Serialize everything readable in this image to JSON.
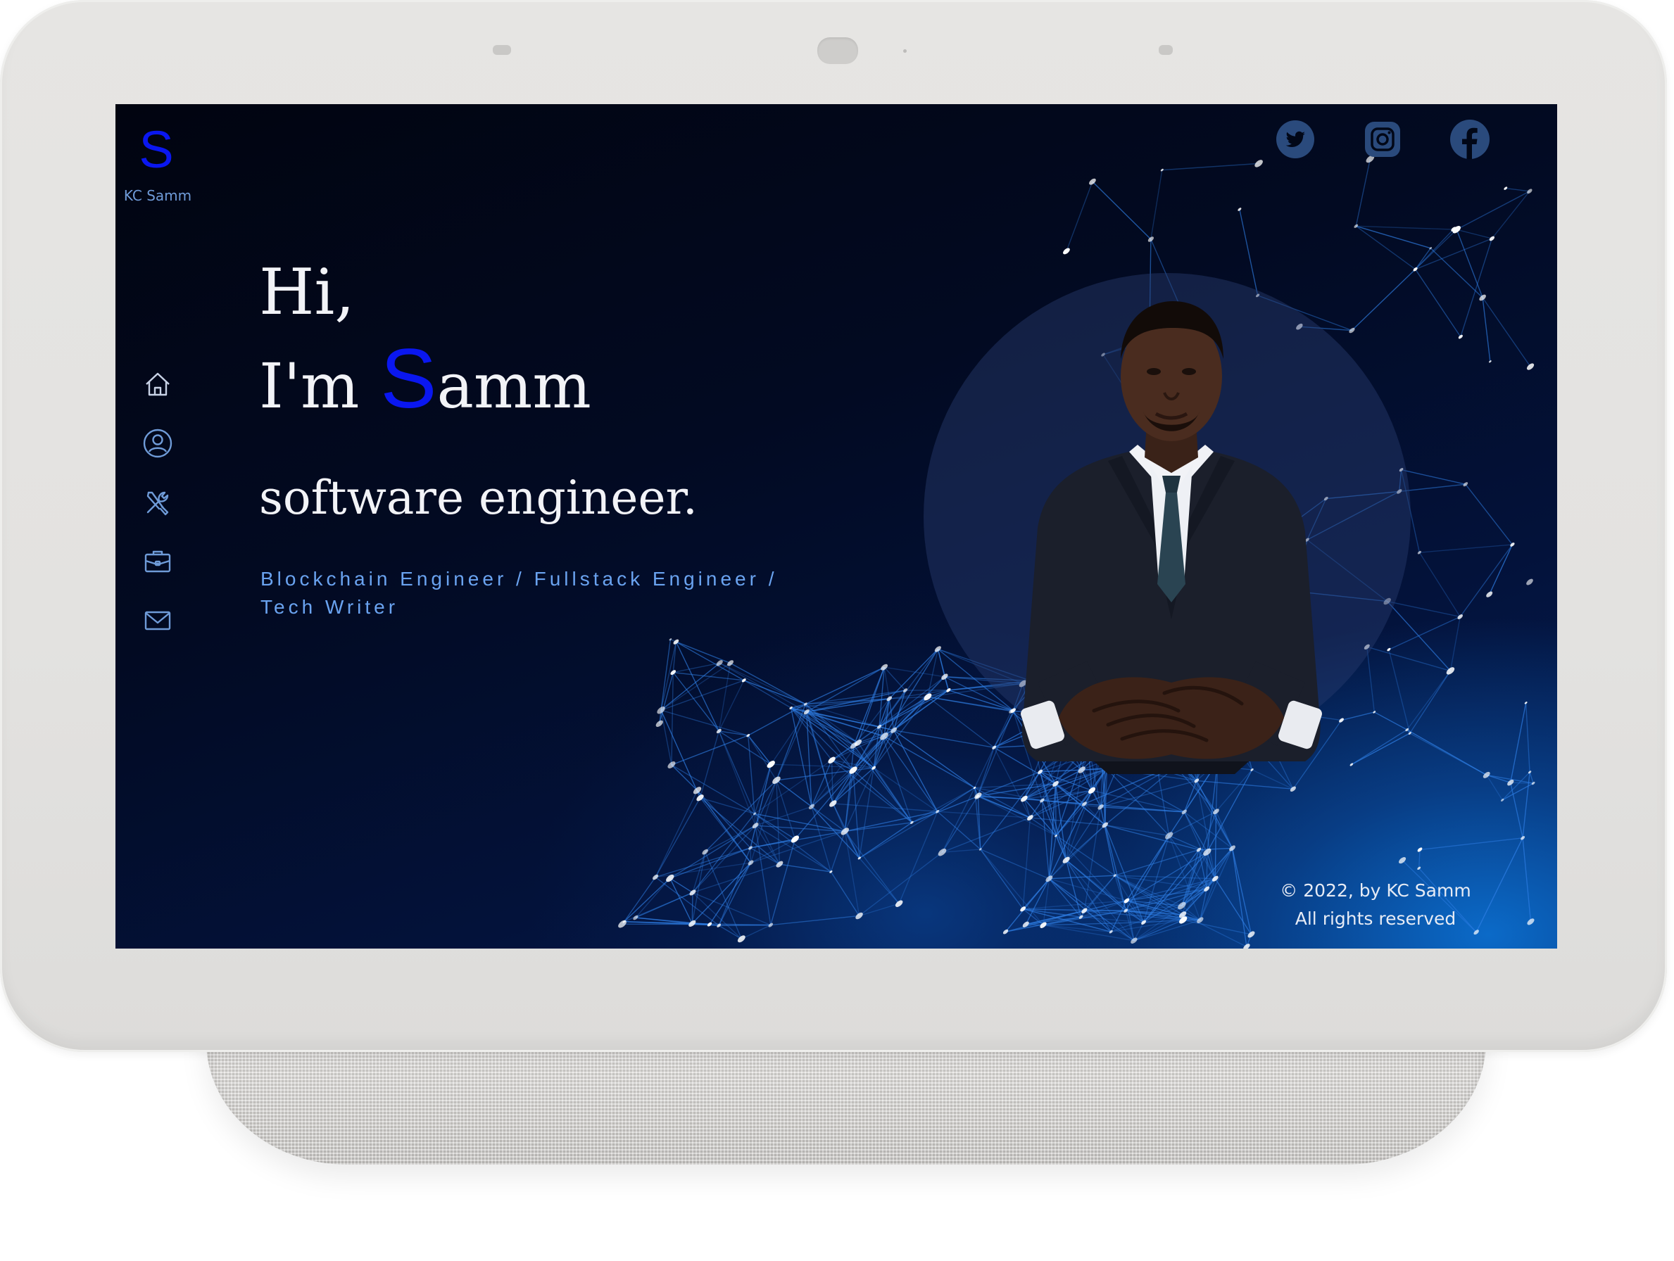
{
  "brand": {
    "logo_letter": "S",
    "name": "KC Samm"
  },
  "nav": [
    {
      "icon": "home-icon"
    },
    {
      "icon": "user-icon"
    },
    {
      "icon": "tools-icon"
    },
    {
      "icon": "briefcase-icon"
    },
    {
      "icon": "mail-icon"
    }
  ],
  "social": [
    {
      "icon": "twitter-icon"
    },
    {
      "icon": "instagram-icon"
    },
    {
      "icon": "facebook-icon"
    }
  ],
  "hero": {
    "greeting": "Hi,",
    "intro_prefix": "I'm",
    "highlight_letter": "S",
    "name_rest": "amm",
    "role": "software engineer.",
    "tagline_line1": "Blockchain Engineer / Fullstack Engineer /",
    "tagline_line2": "Tech Writer"
  },
  "footer": {
    "copyright": "© 2022, by KC Samm",
    "rights": "All rights reserved"
  },
  "colors": {
    "accent": "#0a17f0",
    "tagline": "#6aa3f0",
    "nav_icon": "#6f9bd8",
    "social_icon": "#2a4a7c",
    "device_frame": "#e4e3e1",
    "background_dark": "#020a22"
  }
}
